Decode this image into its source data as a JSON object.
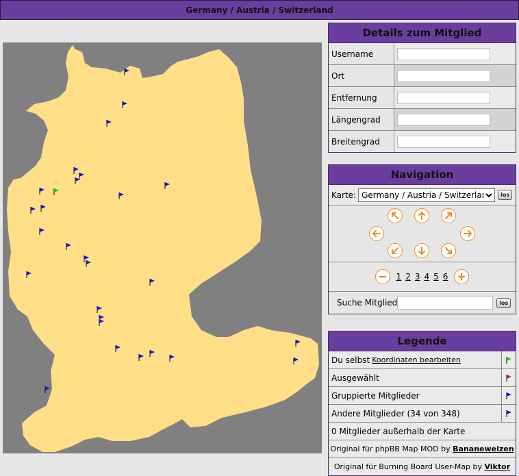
{
  "window": {
    "title": "Germany / Austria / Switzerland"
  },
  "details": {
    "title": "Details zum Mitglied",
    "fields": [
      {
        "label": "Username",
        "value": ""
      },
      {
        "label": "Ort",
        "value": ""
      },
      {
        "label": "Entfernung",
        "value": ""
      },
      {
        "label": "Längengrad",
        "value": ""
      },
      {
        "label": "Breitengrad",
        "value": ""
      }
    ]
  },
  "navigation": {
    "title": "Navigation",
    "map_label": "Karte:",
    "map_selected": "Germany / Austria / Switzerland",
    "go_label": "los",
    "zoom_levels": [
      "1",
      "2",
      "3",
      "4",
      "5",
      "6"
    ],
    "search_label": "Suche Mitglied",
    "search_value": ""
  },
  "legend": {
    "title": "Legende",
    "self_label": "Du selbst",
    "self_link": "Koordinaten bearbeiten",
    "selected_label": "Ausgewählt",
    "grouped_label": "Gruppierte Mitglieder",
    "others_label": "Andere Mitglieder (34 von 348)",
    "outside_label": "0 Mitglieder außerhalb der Karte",
    "credit1_prefix": "Original für phpBB Map MOD by",
    "credit1_author": "Bananeweizen",
    "credit2_prefix": "Original für Burning Board User-Map by",
    "credit2_author": "Viktor"
  },
  "colors": {
    "header": "#6a3e9e",
    "map_land": "#fedf88",
    "map_water": "#808080",
    "flag_self": "#22c022",
    "flag_selected": "#e01010",
    "flag_member": "#1515d8",
    "arrow": "#f08a1d"
  }
}
